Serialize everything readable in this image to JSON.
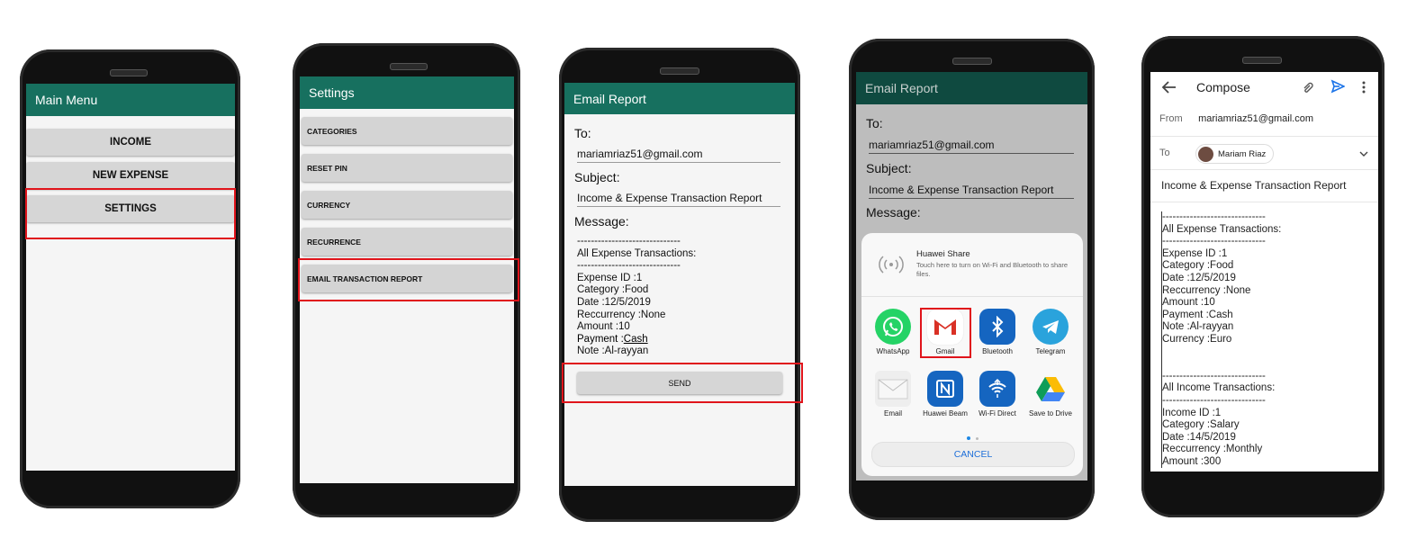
{
  "phone1": {
    "title": "Main Menu",
    "buttons": [
      "INCOME",
      "NEW EXPENSE",
      "SETTINGS"
    ]
  },
  "phone2": {
    "title": "Settings",
    "items": [
      "CATEGORIES",
      "RESET PIN",
      "CURRENCY",
      "RECURRENCE",
      "EMAIL TRANSACTION REPORT"
    ]
  },
  "phone3": {
    "title": "Email Report",
    "to_label": "To:",
    "to_value": "mariamriaz51@gmail.com",
    "subject_label": "Subject:",
    "subject_value": "Income & Expense Transaction Report",
    "message_label": "Message:",
    "message_lines": [
      "------------------------------",
      "All Expense Transactions:",
      "------------------------------",
      "Expense ID :1",
      "Category :Food",
      "Date :12/5/2019",
      "Reccurrency :None",
      "Amount :10",
      "Payment :",
      "Note :Al-rayyan"
    ],
    "payment_value": "Cash",
    "send_label": "SEND"
  },
  "phone4": {
    "title": "Email Report",
    "to_label": "To:",
    "to_value": "mariamriaz51@gmail.com",
    "subject_label": "Subject:",
    "subject_value": "Income & Expense Transaction Report",
    "message_label": "Message:",
    "huawei_share_title": "Huawei Share",
    "huawei_share_desc": "Touch here to turn on Wi-Fi and Bluetooth to share files.",
    "apps": [
      "WhatsApp",
      "Gmail",
      "Bluetooth",
      "Telegram",
      "Email",
      "Huawei Beam",
      "Wi-Fi Direct",
      "Save to Drive"
    ],
    "cancel_label": "CANCEL"
  },
  "phone5": {
    "compose_title": "Compose",
    "from_label": "From",
    "from_value": "mariamriaz51@gmail.com",
    "to_label": "To",
    "to_chip": "Mariam Riaz",
    "subject": "Income & Expense Transaction Report",
    "body": "------------------------------\nAll Expense Transactions:\n------------------------------\nExpense ID :1\nCategory :Food\nDate :12/5/2019\nReccurrency :None\nAmount :10\nPayment :Cash\nNote :Al-rayyan\nCurrency :Euro\n\n\n------------------------------\nAll Income Transactions:\n------------------------------\nIncome ID :1\nCategory :Salary\nDate :14/5/2019\nReccurrency :Monthly\nAmount :300"
  },
  "colors": {
    "appbar": "#17705f",
    "highlight": "#e0141b",
    "gmail_accent": "#1a73e8"
  }
}
